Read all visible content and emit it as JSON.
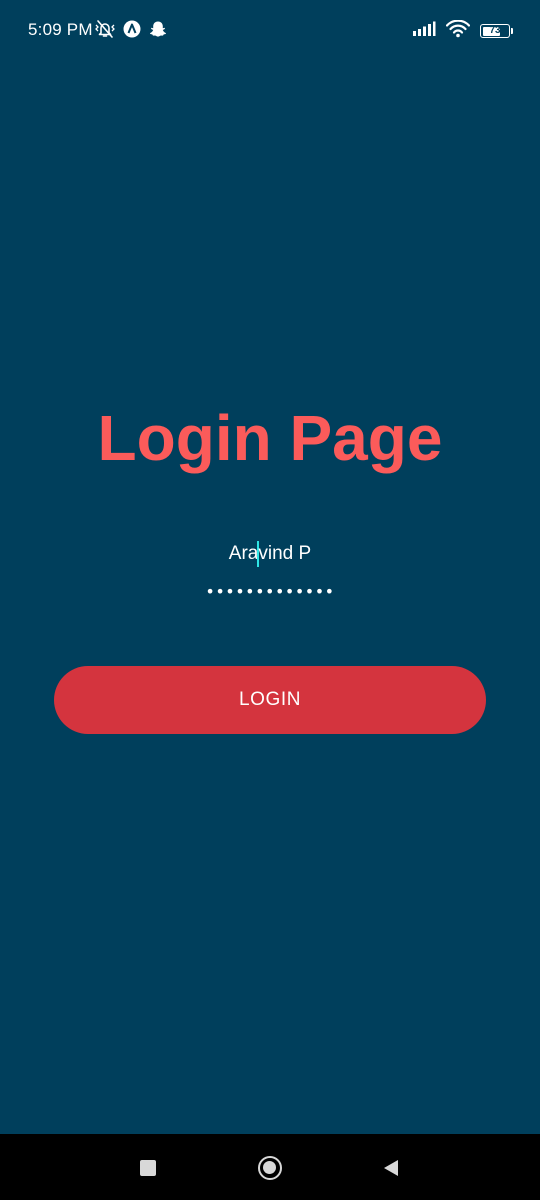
{
  "status_bar": {
    "time": "5:09 PM",
    "left_icons": [
      "muted-vibrate-icon",
      "app-notification-icon",
      "snapchat-icon"
    ],
    "right_icons": [
      "cellular-signal-icon",
      "wifi-icon",
      "battery-icon"
    ],
    "battery_level": "73",
    "battery_fraction": 0.73
  },
  "login": {
    "title": "Login Page",
    "username_value_before_caret": "Ara",
    "username_value_after_caret": "vind P",
    "password_masked": "•••••••••••••",
    "button_label": "LOGIN"
  },
  "nav_bar": {
    "buttons": [
      "recents-button",
      "home-button",
      "back-button"
    ]
  },
  "colors": {
    "background": "#003f5c",
    "title": "#fb5b5a",
    "button": "#d4343e",
    "caret": "#2ee6e6",
    "nav_bar": "#000000"
  }
}
